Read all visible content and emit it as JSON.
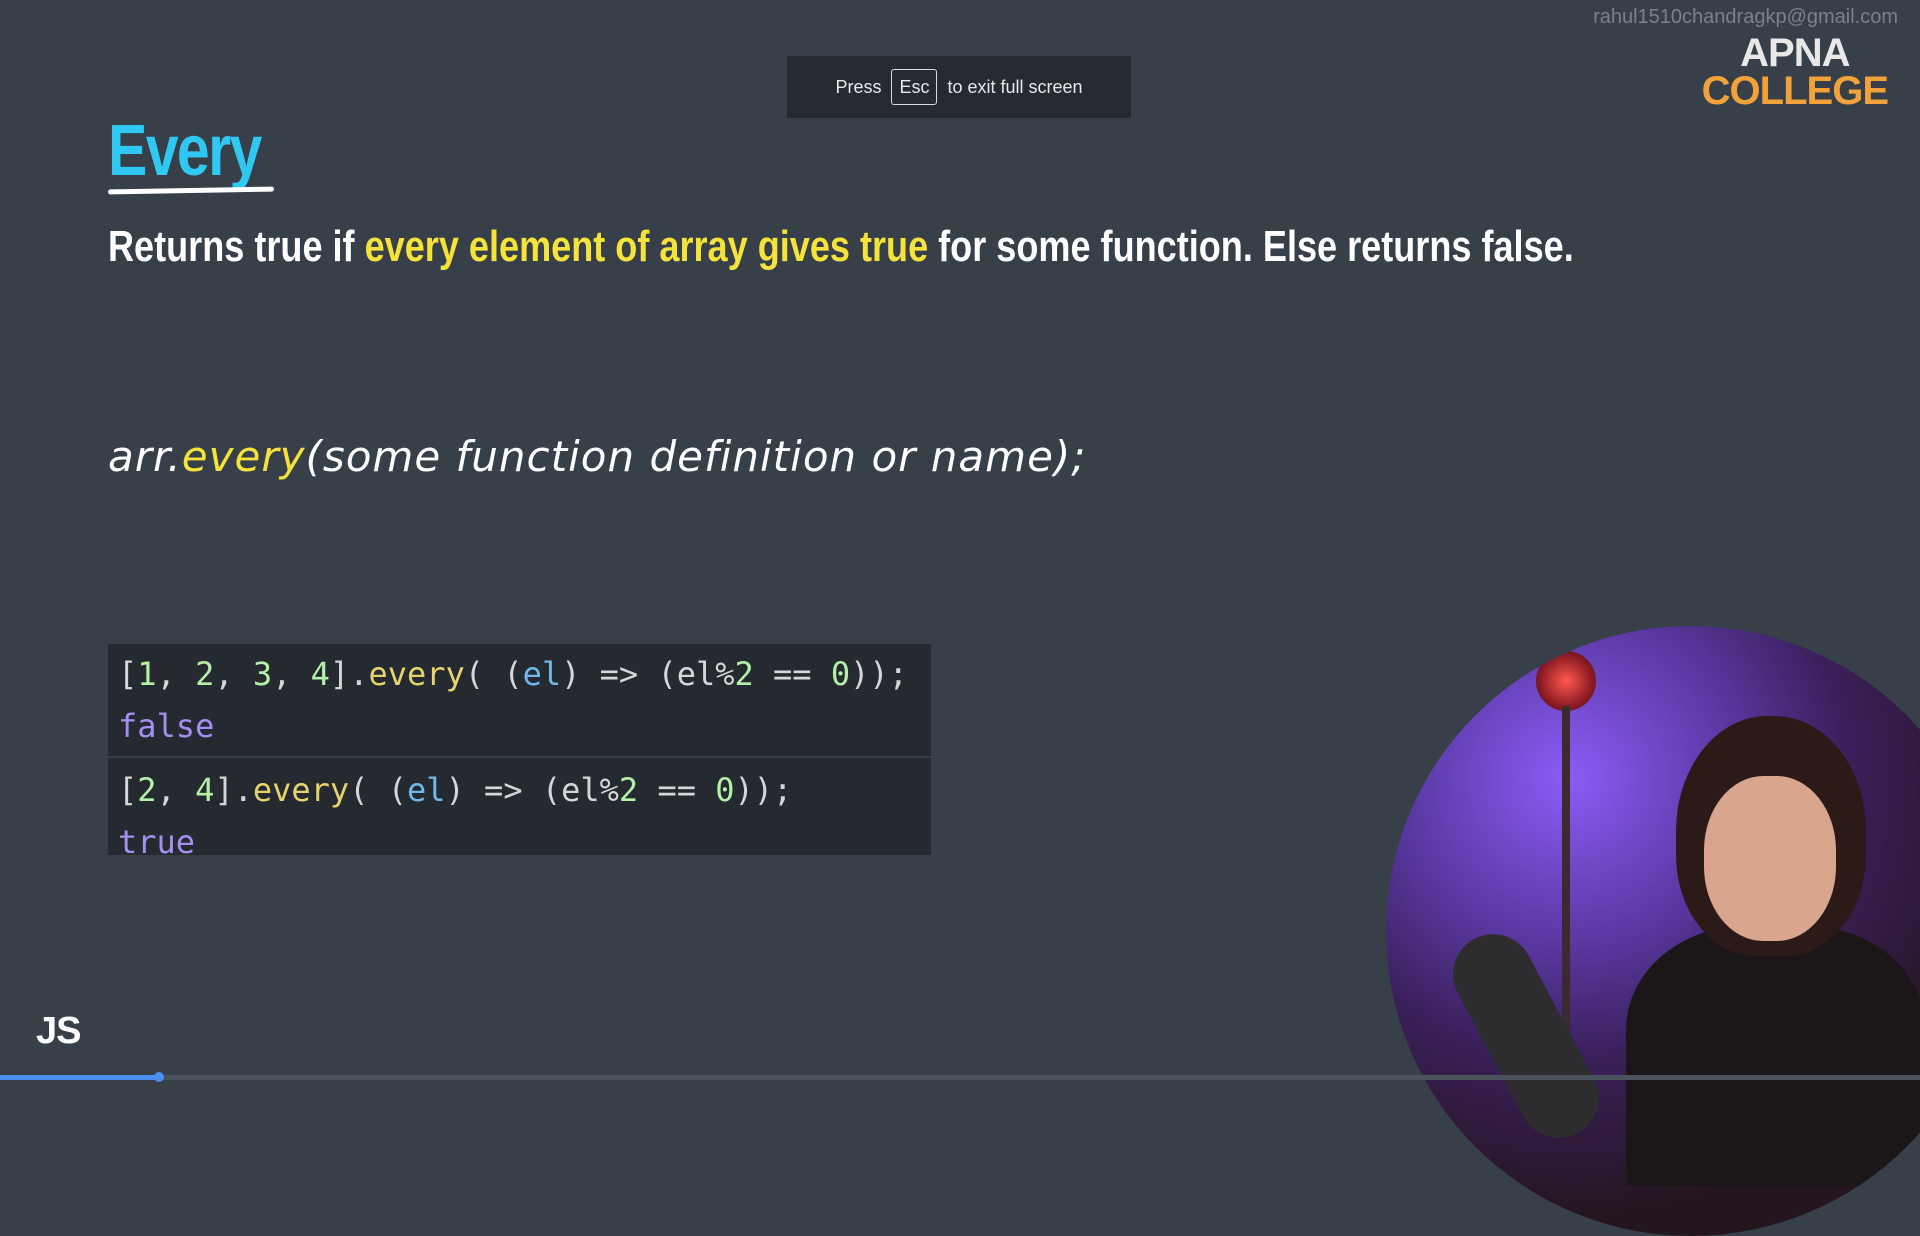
{
  "watermark": "rahul1510chandragkp@gmail.com",
  "fullscreen_toast": {
    "press": "Press",
    "key": "Esc",
    "rest": "to exit full screen"
  },
  "logo": {
    "line1": "APNA",
    "line2": "COLLEGE"
  },
  "slide": {
    "title": "Every",
    "description": {
      "part1": "Returns true if ",
      "highlight": "every element of array gives true",
      "part2": " for some function. Else returns false."
    },
    "syntax": {
      "obj": "arr.",
      "method": "every",
      "args": "(some function definition or name);"
    },
    "code": {
      "example1": {
        "array_open": "[",
        "nums": [
          "1",
          "2",
          "3",
          "4"
        ],
        "array_close": "].",
        "method": "every",
        "paren_open": "( (",
        "param": "el",
        "arrow": ") => (",
        "expr_var": "el%",
        "expr_num": "2",
        "expr_op": " == ",
        "expr_zero": "0",
        "end": "));",
        "result": "false"
      },
      "example2": {
        "array_open": "[",
        "nums": [
          "2",
          "4"
        ],
        "array_close": "].",
        "method": "every",
        "paren_open": "( (",
        "param": "el",
        "arrow": ") => (",
        "expr_var": "el%",
        "expr_num": "2",
        "expr_op": " == ",
        "expr_zero": "0",
        "end": "));",
        "result": "true"
      }
    }
  },
  "badge": "JS",
  "video": {
    "progress_fraction": 0.083
  },
  "colors": {
    "background": "#373f48",
    "title": "#2ec8f2",
    "highlight": "#f5e33a",
    "logo_accent": "#f2a23a",
    "progress": "#4b8ff0"
  }
}
